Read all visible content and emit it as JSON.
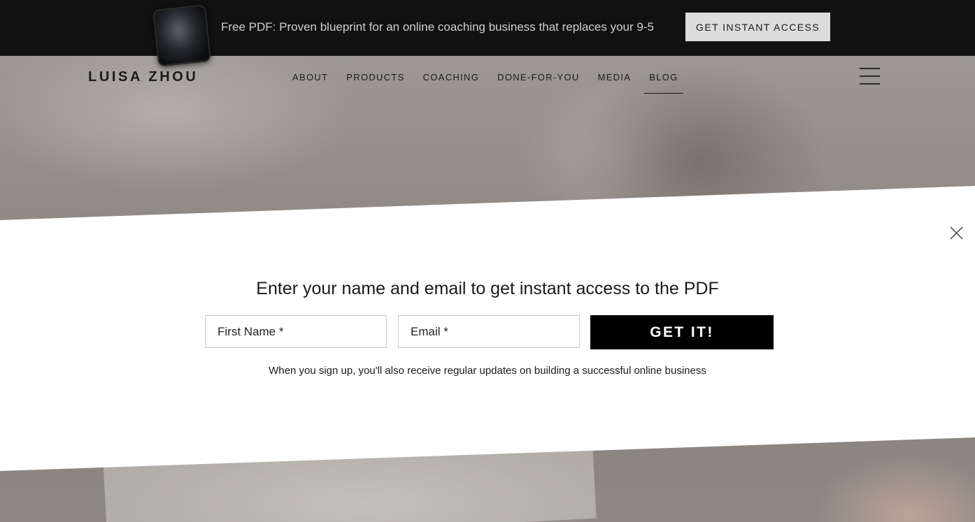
{
  "promo": {
    "text": "Free PDF: Proven blueprint for an online coaching business that replaces your 9-5",
    "button": "GET INSTANT ACCESS"
  },
  "brand": {
    "logo": "LUISA ZHOU"
  },
  "nav": {
    "items": [
      {
        "label": "ABOUT"
      },
      {
        "label": "PRODUCTS"
      },
      {
        "label": "COACHING"
      },
      {
        "label": "DONE-FOR-YOU"
      },
      {
        "label": "MEDIA"
      },
      {
        "label": "BLOG"
      }
    ],
    "active": "BLOG"
  },
  "optin": {
    "heading": "Enter your name and email to get instant access to the PDF",
    "first_name_placeholder": "First Name *",
    "email_placeholder": "Email *",
    "submit": "GET IT!",
    "disclaimer": "When you sign up, you'll also receive regular updates on building a successful online business"
  },
  "colors": {
    "promo_bg": "#111111",
    "button_dark": "#000000",
    "button_light": "#dcdcdc"
  },
  "icons": [
    "phone-image",
    "menu-icon",
    "close-icon"
  ]
}
